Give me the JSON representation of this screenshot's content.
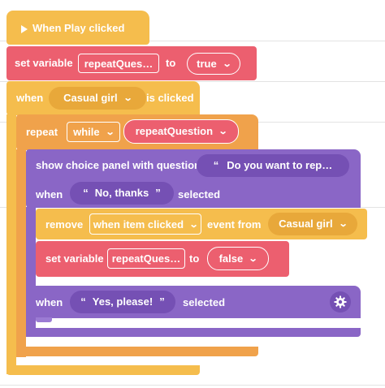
{
  "events": {
    "play_block": {
      "label": "When Play clicked",
      "icon": "play-icon"
    },
    "set_var_1": {
      "prefix": "set variable",
      "variable": "repeatQues…",
      "to": "to",
      "value": "true"
    },
    "when_clicked": {
      "when": "when",
      "target": "Casual girl",
      "suffix": "is clicked"
    },
    "repeat": {
      "label": "repeat",
      "mode": "while",
      "condition": "repeatQuestion"
    },
    "choice_panel": {
      "label": "show choice panel with question",
      "question": "Do you want to rep…",
      "option1_when": "when",
      "option1": "No, thanks",
      "option1_suffix": "selected",
      "option2_when": "when",
      "option2": "Yes, please!",
      "option2_suffix": "selected",
      "settings_icon": "gear-icon"
    },
    "remove": {
      "label": "remove",
      "event": "when item clicked",
      "from": "event from",
      "target": "Casual girl"
    },
    "set_var_2": {
      "prefix": "set variable",
      "variable": "repeatQues…",
      "to": "to",
      "value": "false"
    }
  },
  "colors": {
    "event_yellow": "#f5bd4d",
    "variable_red": "#ec5f6f",
    "control_orange": "#f0a24b",
    "dialog_purple": "#8a66c6"
  }
}
